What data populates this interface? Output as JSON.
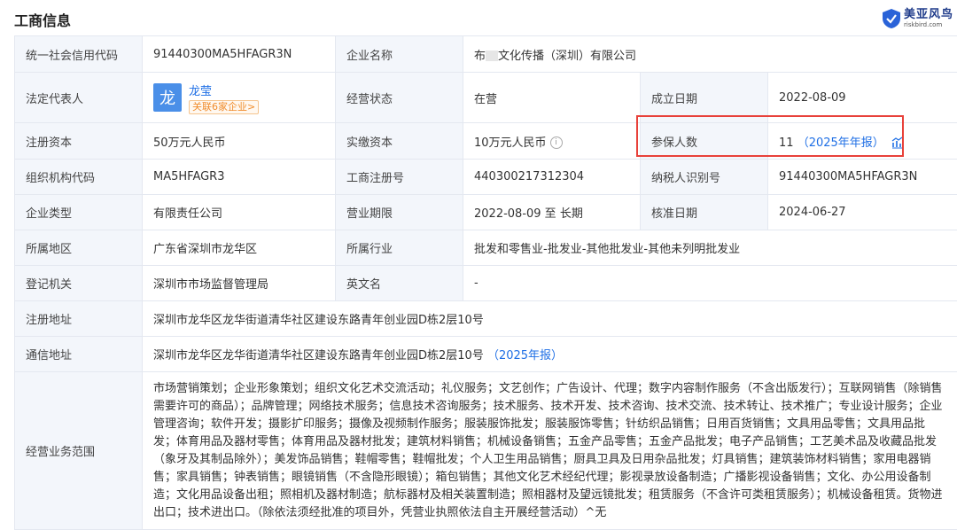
{
  "header": {
    "title": "工商信息",
    "brand_name": "美亚风鸟",
    "brand_url": "riskbird.com"
  },
  "rows": {
    "credit_code": {
      "label": "统一社会信用代码",
      "value": "91440300MA5HFAGR3N"
    },
    "company_name": {
      "label": "企业名称",
      "value_prefix": "布",
      "value_suffix": "文化传播（深圳）有限公司"
    },
    "legal_rep": {
      "label": "法定代表人",
      "avatar": "龙",
      "name": "龙莹",
      "tag": "关联6家企业>"
    },
    "status": {
      "label": "经营状态",
      "value": "在营"
    },
    "established": {
      "label": "成立日期",
      "value": "2022-08-09"
    },
    "reg_capital": {
      "label": "注册资本",
      "value": "50万元人民币"
    },
    "paid_capital": {
      "label": "实缴资本",
      "value": "10万元人民币"
    },
    "insured": {
      "label": "参保人数",
      "value": "11",
      "note": "（2025年年报）"
    },
    "org_code": {
      "label": "组织机构代码",
      "value": "MA5HFAGR3"
    },
    "reg_no": {
      "label": "工商注册号",
      "value": "440300217312304"
    },
    "taxpayer_id": {
      "label": "纳税人识别号",
      "value": "91440300MA5HFAGR3N"
    },
    "company_type": {
      "label": "企业类型",
      "value": "有限责任公司"
    },
    "term": {
      "label": "营业期限",
      "value": "2022-08-09 至 长期"
    },
    "approval_date": {
      "label": "核准日期",
      "value": "2024-06-27"
    },
    "region": {
      "label": "所属地区",
      "value": "广东省深圳市龙华区"
    },
    "industry": {
      "label": "所属行业",
      "value": "批发和零售业-批发业-其他批发业-其他未列明批发业"
    },
    "authority": {
      "label": "登记机关",
      "value": "深圳市市场监督管理局"
    },
    "english_name": {
      "label": "英文名",
      "value": "-"
    },
    "reg_address": {
      "label": "注册地址",
      "value": "深圳市龙华区龙华街道清华社区建设东路青年创业园D栋2层10号"
    },
    "mail_address": {
      "label": "通信地址",
      "value": "深圳市龙华区龙华街道清华社区建设东路青年创业园D栋2层10号",
      "note": "（2025年报）"
    },
    "scope": {
      "label": "经营业务范围",
      "value": "市场营销策划；企业形象策划；组织文化艺术交流活动；礼仪服务；文艺创作；广告设计、代理；数字内容制作服务（不含出版发行）；互联网销售（除销售需要许可的商品）；品牌管理；网络技术服务；信息技术咨询服务；技术服务、技术开发、技术咨询、技术交流、技术转让、技术推广；专业设计服务；企业管理咨询；软件开发；摄影扩印服务；摄像及视频制作服务；服装服饰批发；服装服饰零售；针纺织品销售；日用百货销售；文具用品零售；文具用品批发；体育用品及器材零售；体育用品及器材批发；建筑材料销售；机械设备销售；五金产品零售；五金产品批发；电子产品销售；工艺美术品及收藏品批发（象牙及其制品除外）；美发饰品销售；鞋帽零售；鞋帽批发；个人卫生用品销售；厨具卫具及日用杂品批发；灯具销售；建筑装饰材料销售；家用电器销售；家具销售；钟表销售；眼镜销售（不含隐形眼镜）；箱包销售；其他文化艺术经纪代理；影视录放设备制造；广播影视设备销售；文化、办公用设备制造；文化用品设备出租；照相机及器材制造；航标器材及相关装置制造；照相器材及望远镜批发；租赁服务（不含许可类租赁服务）；机械设备租赁。货物进出口；技术进出口。（除依法须经批准的项目外，凭营业执照依法自主开展经营活动）^无"
    }
  }
}
